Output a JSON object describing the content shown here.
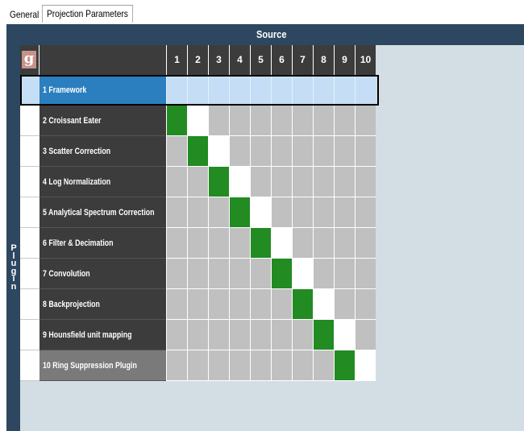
{
  "tabs": [
    {
      "label": "General",
      "active": false
    },
    {
      "label": "Projection Parameters",
      "active": true
    }
  ],
  "grid": {
    "source_label": "Source",
    "plugin_label": "Plugin",
    "logo_letter": "g",
    "columns": [
      "1",
      "2",
      "3",
      "4",
      "5",
      "6",
      "7",
      "8",
      "9",
      "10"
    ],
    "rows": [
      {
        "label": "1 Framework",
        "green": null,
        "white": null,
        "selected": true
      },
      {
        "label": "2 Croissant Eater",
        "green": 1,
        "white": 2
      },
      {
        "label": "3 Scatter Correction",
        "green": 2,
        "white": 3
      },
      {
        "label": "4 Log Normalization",
        "green": 3,
        "white": 4
      },
      {
        "label": "5 Analytical Spectrum Correction",
        "green": 4,
        "white": 5
      },
      {
        "label": "6 Filter & Decimation",
        "green": 5,
        "white": 6
      },
      {
        "label": "7 Convolution",
        "green": 6,
        "white": 7
      },
      {
        "label": "8 Backprojection",
        "green": 7,
        "white": 8
      },
      {
        "label": "9 Hounsfield unit mapping",
        "green": 8,
        "white": 9
      },
      {
        "label": "10 Ring Suppression Plugin",
        "green": 9,
        "white": 10
      }
    ]
  },
  "colors": {
    "header_bg": "#2e4760",
    "name_cell_bg": "#3c3c3c",
    "connection_on": "#228b22",
    "selected_row": "#2c7fbf",
    "panel_bg": "#d3dee4"
  }
}
